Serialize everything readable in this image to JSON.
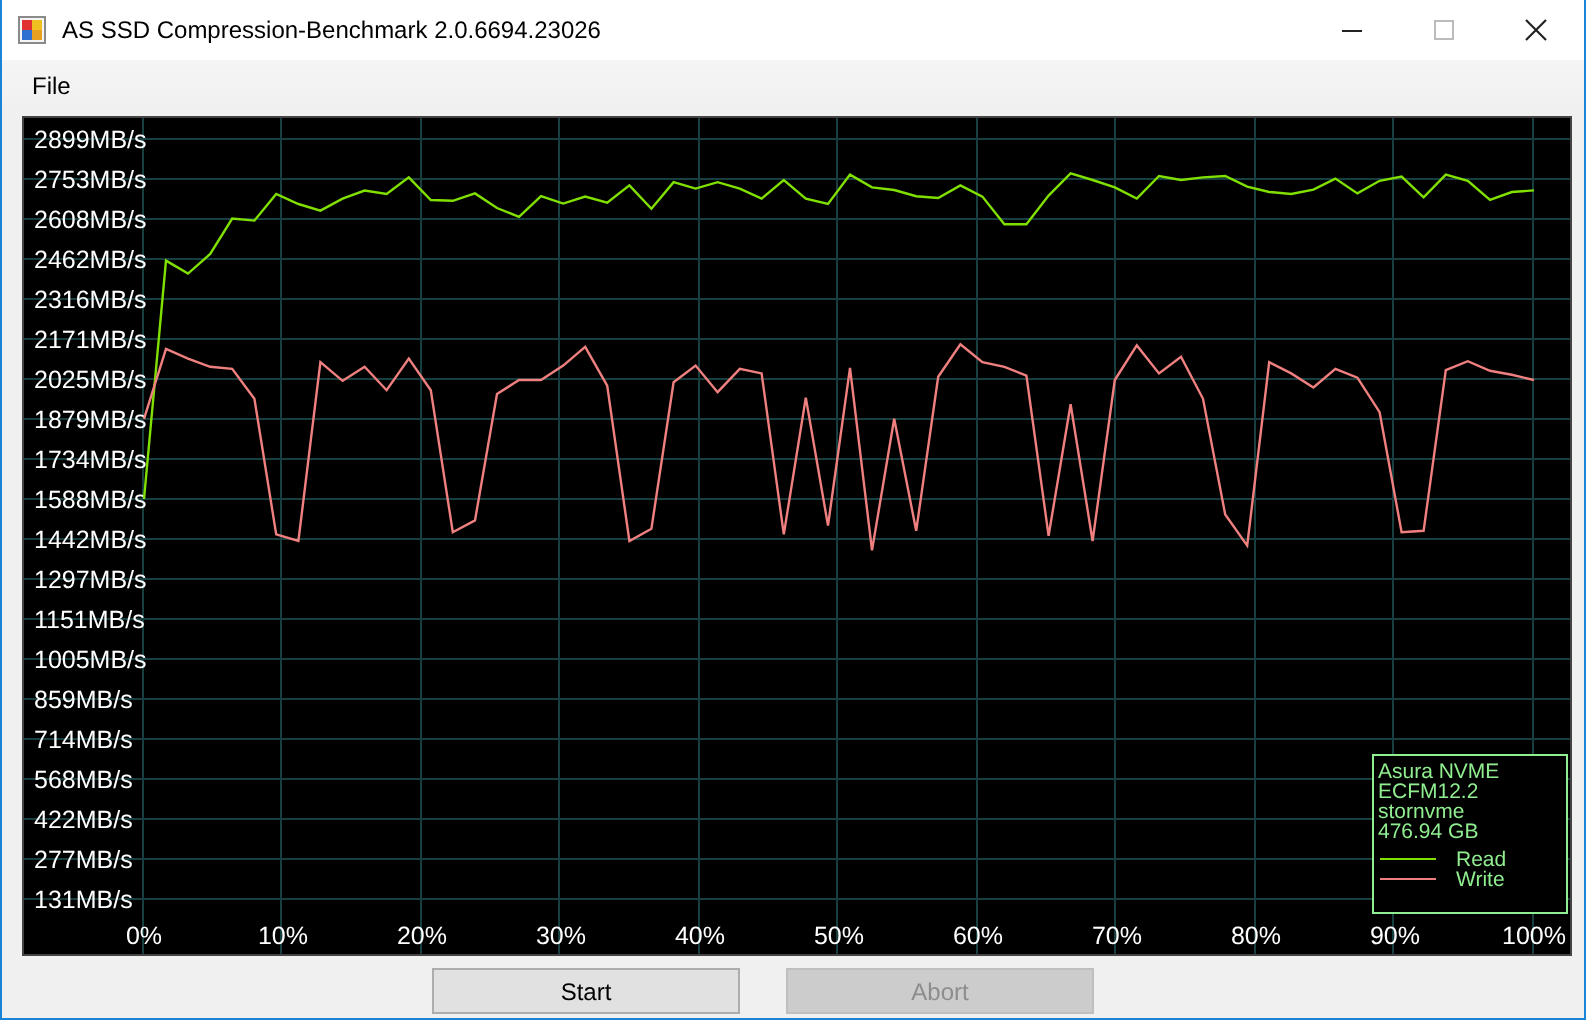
{
  "window": {
    "title": "AS SSD Compression-Benchmark 2.0.6694.23026"
  },
  "menu": [
    {
      "label": "File"
    }
  ],
  "chart": {
    "legend_info": [
      "Asura NVME",
      "ECFM12.2",
      "stornvme",
      "476.94 GB"
    ],
    "chart_data": {
      "type": "line",
      "x": [
        0,
        1.59,
        3.17,
        4.76,
        6.35,
        7.94,
        9.52,
        11.11,
        12.7,
        14.29,
        15.87,
        17.46,
        19.05,
        20.63,
        22.22,
        23.81,
        25.4,
        26.98,
        28.57,
        30.16,
        31.75,
        33.33,
        34.92,
        36.51,
        38.1,
        39.68,
        41.27,
        42.86,
        44.44,
        46.03,
        47.62,
        49.21,
        50.79,
        52.38,
        53.97,
        55.56,
        57.14,
        58.73,
        60.32,
        61.9,
        63.49,
        65.08,
        66.67,
        68.25,
        69.84,
        71.43,
        73.02,
        74.6,
        76.19,
        77.78,
        79.37,
        80.95,
        82.54,
        84.13,
        85.71,
        87.3,
        88.89,
        90.48,
        92.06,
        93.65,
        95.24,
        96.83,
        98.41,
        100
      ],
      "series": [
        {
          "name": "Read",
          "color": "#80e000",
          "values": [
            1588,
            2456,
            2409,
            2480,
            2609,
            2602,
            2699,
            2662,
            2638,
            2682,
            2711,
            2699,
            2759,
            2677,
            2674,
            2701,
            2648,
            2616,
            2691,
            2664,
            2689,
            2667,
            2730,
            2645,
            2742,
            2718,
            2742,
            2718,
            2682,
            2750,
            2682,
            2662,
            2769,
            2723,
            2713,
            2691,
            2684,
            2730,
            2689,
            2589,
            2589,
            2693,
            2774,
            2750,
            2723,
            2682,
            2764,
            2750,
            2759,
            2764,
            2726,
            2706,
            2699,
            2715,
            2755,
            2701,
            2747,
            2762,
            2686,
            2769,
            2747,
            2677,
            2706,
            2712
          ]
        },
        {
          "name": "Write",
          "color": "#f08080",
          "values": [
            1880,
            2135,
            2099,
            2069,
            2062,
            1953,
            1459,
            1435,
            2086,
            2018,
            2069,
            1984,
            2099,
            1984,
            1467,
            1510,
            1970,
            2021,
            2021,
            2074,
            2142,
            2001,
            1435,
            1479,
            2013,
            2074,
            1977,
            2062,
            2045,
            1459,
            1957,
            1491,
            2066,
            1401,
            1880,
            1472,
            2033,
            2152,
            2086,
            2069,
            2037,
            1454,
            1933,
            1435,
            2021,
            2147,
            2045,
            2106,
            1953,
            1532,
            1418,
            2086,
            2045,
            1994,
            2062,
            2030,
            1904,
            1467,
            1472,
            2057,
            2090,
            2055,
            2040,
            2021
          ]
        }
      ],
      "xlim": [
        -8.63,
        102.59
      ],
      "ylim": [
        131,
        2899
      ],
      "grid": true,
      "legend": true,
      "xticks": [
        {
          "value": 0,
          "label": "0%"
        },
        {
          "value": 10,
          "label": "10%"
        },
        {
          "value": 20,
          "label": "20%"
        },
        {
          "value": 30,
          "label": "30%"
        },
        {
          "value": 40,
          "label": "40%"
        },
        {
          "value": 50,
          "label": "50%"
        },
        {
          "value": 60,
          "label": "60%"
        },
        {
          "value": 70,
          "label": "70%"
        },
        {
          "value": 80,
          "label": "80%"
        },
        {
          "value": 90,
          "label": "90%"
        },
        {
          "value": 100,
          "label": "100%"
        }
      ],
      "yticks": [
        {
          "value": 2899,
          "label": "2899MB/s"
        },
        {
          "value": 2753,
          "label": "2753MB/s"
        },
        {
          "value": 2608,
          "label": "2608MB/s"
        },
        {
          "value": 2462,
          "label": "2462MB/s"
        },
        {
          "value": 2316,
          "label": "2316MB/s"
        },
        {
          "value": 2171,
          "label": "2171MB/s"
        },
        {
          "value": 2025,
          "label": "2025MB/s"
        },
        {
          "value": 1879,
          "label": "1879MB/s"
        },
        {
          "value": 1734,
          "label": "1734MB/s"
        },
        {
          "value": 1588,
          "label": "1588MB/s"
        },
        {
          "value": 1442,
          "label": "1442MB/s"
        },
        {
          "value": 1297,
          "label": "1297MB/s"
        },
        {
          "value": 1151,
          "label": "1151MB/s"
        },
        {
          "value": 1005,
          "label": "1005MB/s"
        },
        {
          "value": 859,
          "label": "859MB/s"
        },
        {
          "value": 714,
          "label": "714MB/s"
        },
        {
          "value": 568,
          "label": "568MB/s"
        },
        {
          "value": 422,
          "label": "422MB/s"
        },
        {
          "value": 277,
          "label": "277MB/s"
        },
        {
          "value": 131,
          "label": "131MB/s"
        }
      ]
    }
  },
  "buttons": [
    {
      "label": "Start",
      "disabled": false
    },
    {
      "label": "Abort",
      "disabled": true
    }
  ]
}
